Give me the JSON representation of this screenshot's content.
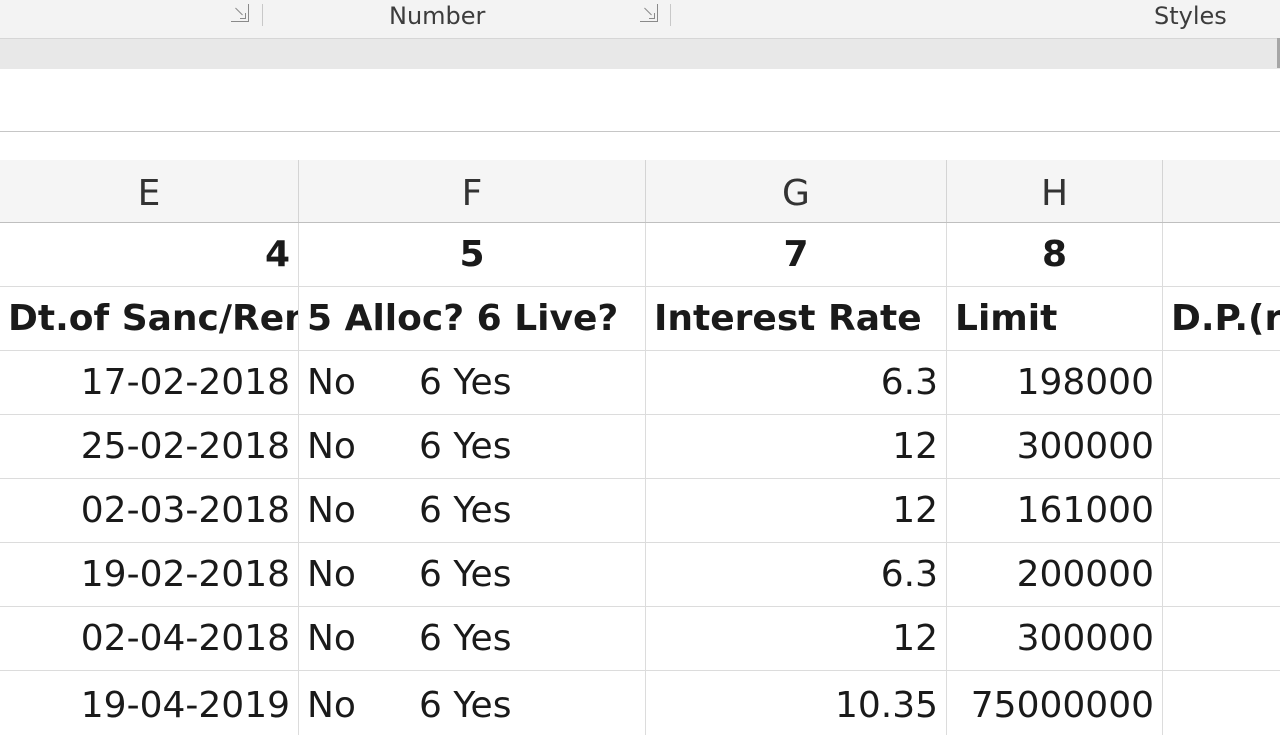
{
  "ribbon": {
    "groups": [
      "Number",
      "Styles"
    ]
  },
  "columns": [
    "E",
    "F",
    "G",
    "H"
  ],
  "rows": {
    "numbers": {
      "E": "4",
      "F": "5",
      "G": "7",
      "H": "8"
    },
    "headers": {
      "E": "Dt.of Sanc/Ren",
      "F": "5 Alloc? 6 Live?",
      "G": "Interest Rate",
      "H": "Limit",
      "I": "D.P.(r"
    },
    "data": [
      {
        "E": "17-02-2018",
        "F_a": "No",
        "F_b": "6 Yes",
        "G": "6.3",
        "H": "198000"
      },
      {
        "E": "25-02-2018",
        "F_a": "No",
        "F_b": "6 Yes",
        "G": "12",
        "H": "300000"
      },
      {
        "E": "02-03-2018",
        "F_a": "No",
        "F_b": "6 Yes",
        "G": "12",
        "H": "161000"
      },
      {
        "E": "19-02-2018",
        "F_a": "No",
        "F_b": "6 Yes",
        "G": "6.3",
        "H": "200000"
      },
      {
        "E": "02-04-2018",
        "F_a": "No",
        "F_b": "6 Yes",
        "G": "12",
        "H": "300000"
      },
      {
        "E": "19-04-2019",
        "F_a": "No",
        "F_b": "6 Yes",
        "G": "10.35",
        "H": "75000000"
      }
    ]
  }
}
